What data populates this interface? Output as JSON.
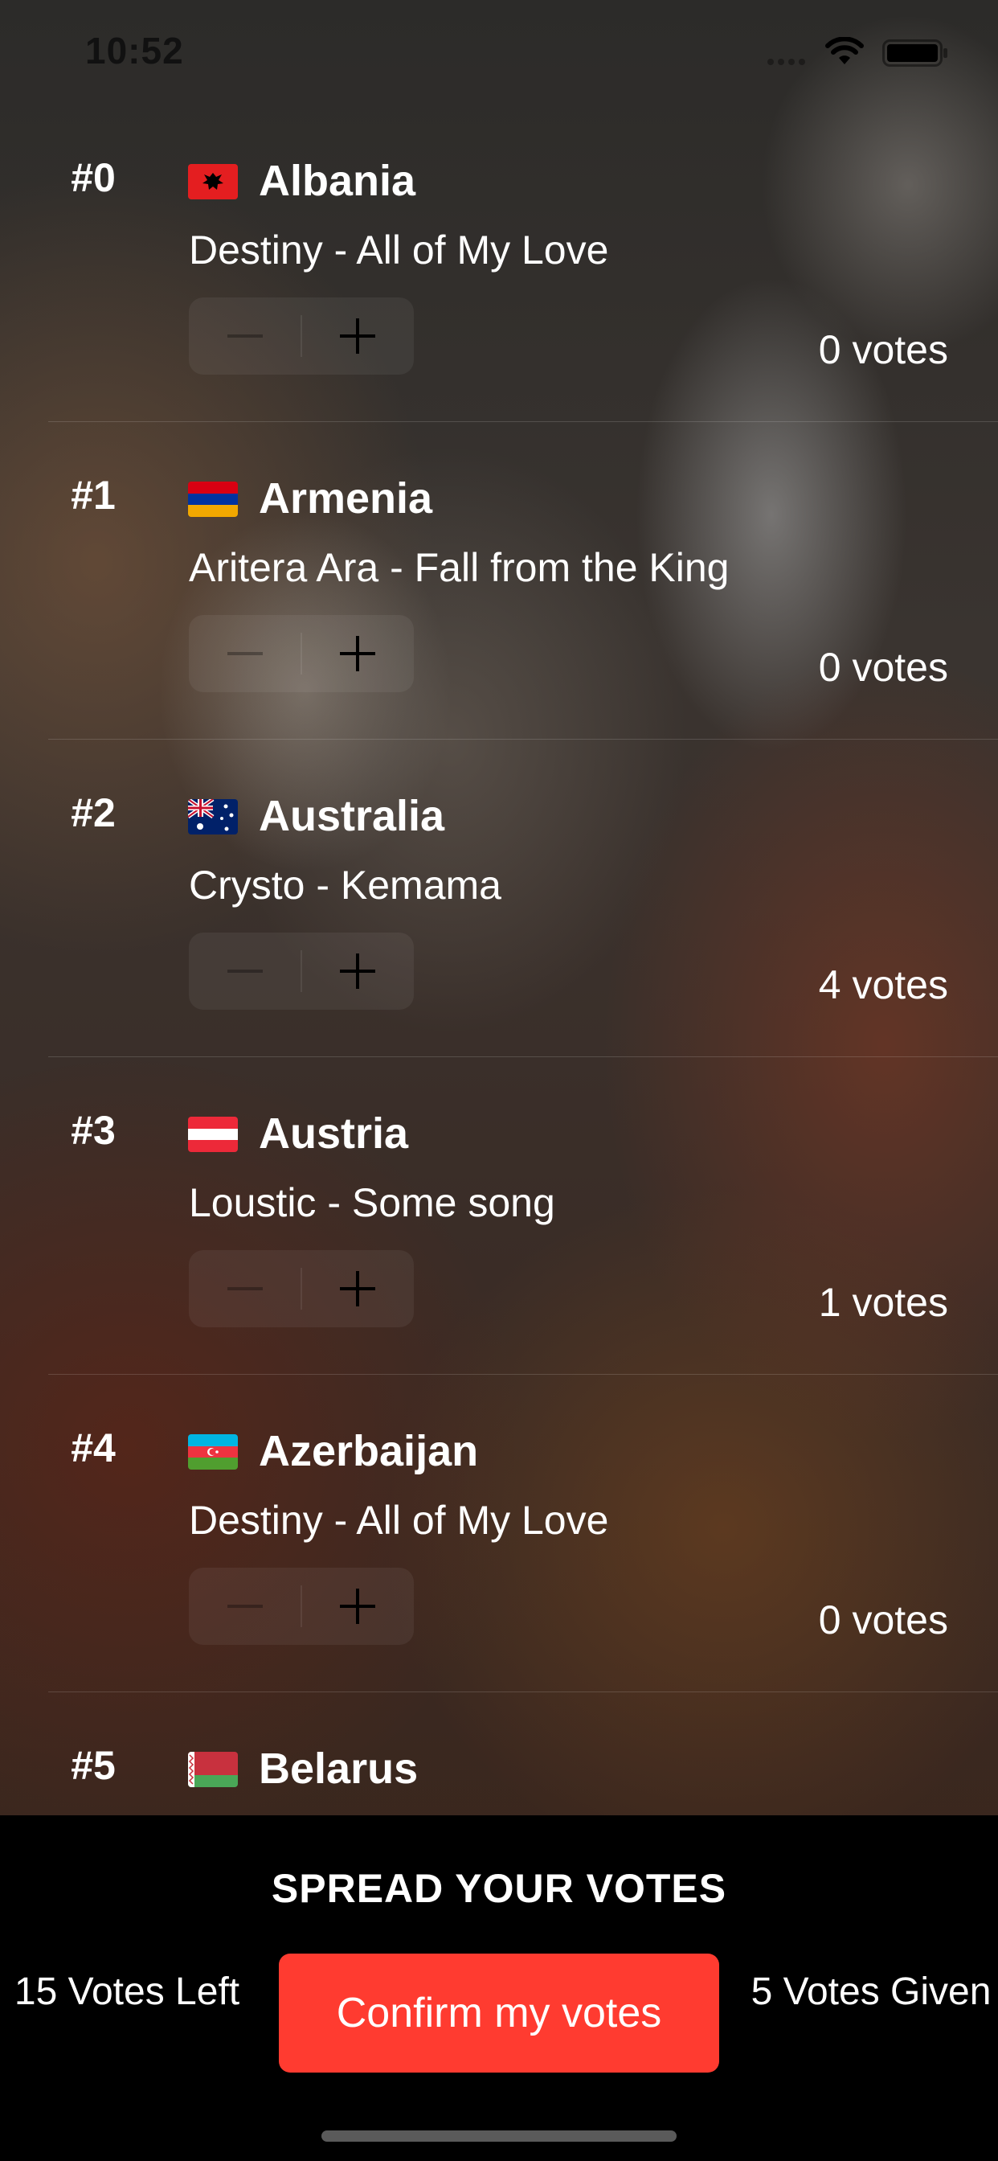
{
  "status_bar": {
    "time": "10:52"
  },
  "entries": [
    {
      "rank": "#0",
      "flag": "albania-flag",
      "country": "Albania",
      "song": "Destiny - All of My Love",
      "votes": "0 votes"
    },
    {
      "rank": "#1",
      "flag": "armenia-flag",
      "country": "Armenia",
      "song": "Aritera Ara - Fall from the King",
      "votes": "0 votes"
    },
    {
      "rank": "#2",
      "flag": "australia-flag",
      "country": "Australia",
      "song": "Crysto - Kemama",
      "votes": "4 votes"
    },
    {
      "rank": "#3",
      "flag": "austria-flag",
      "country": "Austria",
      "song": "Loustic - Some song",
      "votes": "1 votes"
    },
    {
      "rank": "#4",
      "flag": "azerbaijan-flag",
      "country": "Azerbaijan",
      "song": "Destiny - All of My Love",
      "votes": "0 votes"
    },
    {
      "rank": "#5",
      "flag": "belarus-flag",
      "country": "Belarus"
    }
  ],
  "footer": {
    "title": "SPREAD YOUR VOTES",
    "votes_left": "15 Votes Left",
    "confirm_label": "Confirm my votes",
    "votes_given": "5 Votes Given"
  },
  "colors": {
    "accent": "#ff3b30",
    "panel": "#000000"
  }
}
